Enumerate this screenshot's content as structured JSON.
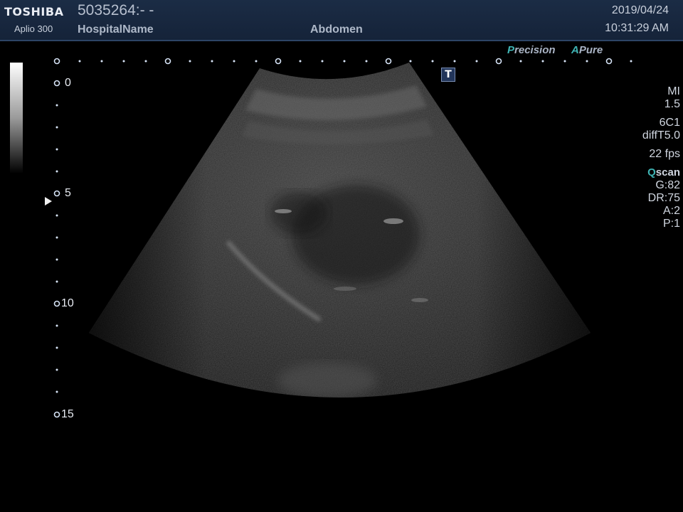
{
  "header": {
    "brand": "TOSHIBA",
    "model": "Aplio 300",
    "patient_id": "5035264:- -",
    "hospital": "HospitalName",
    "preset": "Abdomen",
    "date": "2019/04/24",
    "time": "10:31:29 AM"
  },
  "depth_scale": {
    "labels": [
      "0",
      "5",
      "10",
      "15"
    ]
  },
  "modes": {
    "precision_accent": "P",
    "precision_rest": "recision",
    "apure_accent": "A",
    "apure_rest": "Pure",
    "t_marker": "T"
  },
  "params": {
    "mi_label": "MI",
    "mi_value": "1.5",
    "probe": "6C1",
    "imaging": "diffT5.0",
    "fps": "22 fps",
    "qscan_q": "Q",
    "qscan_rest": "scan",
    "gain": "G:82",
    "dynamic_range": "DR:75",
    "a": "A:2",
    "p": "P:1"
  },
  "colors": {
    "header_bg": "#1b2c45",
    "accent": "#3fb4b4"
  }
}
